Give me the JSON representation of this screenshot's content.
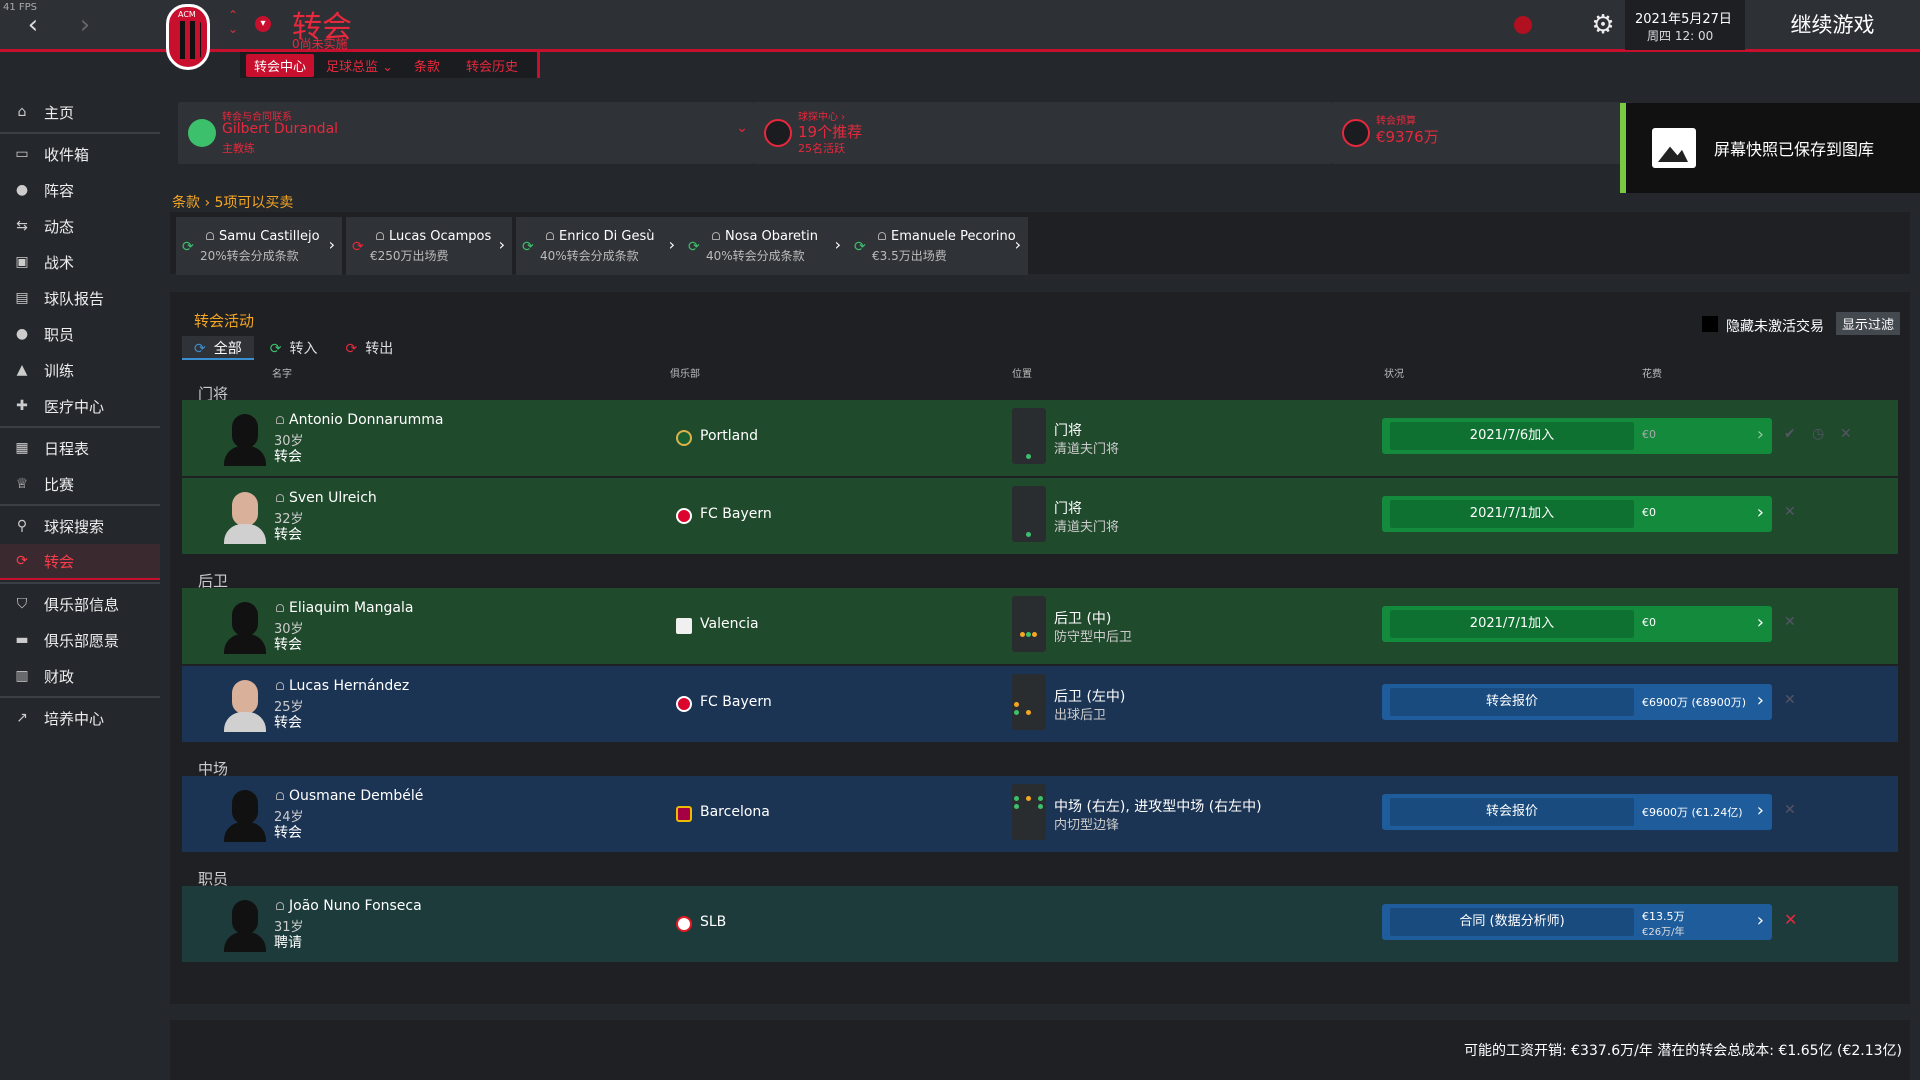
{
  "fps": "41 FPS",
  "header": {
    "title": "转会",
    "subtitle": "0尚未实施",
    "tabs": [
      "转会中心",
      "足球总监",
      "条款",
      "转会历史"
    ],
    "date": "2021年5月27日",
    "day_time": "周四 12: 00",
    "continue_label": "继续游戏",
    "accent_color": "#c8102e"
  },
  "sidebar": {
    "items": [
      {
        "label": "主页",
        "icon": "home-icon"
      },
      {
        "label": "收件箱",
        "icon": "inbox-icon"
      },
      {
        "label": "阵容",
        "icon": "squad-icon"
      },
      {
        "label": "动态",
        "icon": "dynamics-icon"
      },
      {
        "label": "战术",
        "icon": "tactics-icon"
      },
      {
        "label": "球队报告",
        "icon": "report-icon"
      },
      {
        "label": "职员",
        "icon": "staff-icon"
      },
      {
        "label": "训练",
        "icon": "training-icon"
      },
      {
        "label": "医疗中心",
        "icon": "medical-icon"
      },
      {
        "label": "日程表",
        "icon": "calendar-icon"
      },
      {
        "label": "比赛",
        "icon": "trophy-icon"
      },
      {
        "label": "球探搜索",
        "icon": "search-icon"
      },
      {
        "label": "转会",
        "icon": "transfer-icon"
      },
      {
        "label": "俱乐部信息",
        "icon": "shield-icon"
      },
      {
        "label": "俱乐部愿景",
        "icon": "vision-icon"
      },
      {
        "label": "财政",
        "icon": "finance-icon"
      },
      {
        "label": "培养中心",
        "icon": "development-icon"
      }
    ]
  },
  "cards": {
    "contact": {
      "label": "转会与合同联系",
      "name": "Gilbert Durandal",
      "role": "主教练"
    },
    "scouting": {
      "label": "球探中心",
      "value": "19个推荐",
      "sub": "25名活跃"
    },
    "budget": {
      "label": "转会预算",
      "value": "€9376万"
    }
  },
  "toast": {
    "text": "屏幕快照已保存到图库"
  },
  "sell": {
    "link": "条款",
    "title": "5项可以买卖",
    "items": [
      {
        "name": "Samu Castillejo",
        "desc": "20%转会分成条款"
      },
      {
        "name": "Lucas Ocampos",
        "desc": "€250万出场费"
      },
      {
        "name": "Enrico Di Gesù",
        "desc": "40%转会分成条款"
      },
      {
        "name": "Nosa Obaretin",
        "desc": "40%转会分成条款"
      },
      {
        "name": "Emanuele Pecorino",
        "desc": "€3.5万出场费"
      }
    ]
  },
  "activity": {
    "title": "转会活动",
    "filters": [
      "全部",
      "转入",
      "转出"
    ],
    "hide_inactive": "隐藏未激活交易",
    "show_filter": "显示过滤",
    "columns": {
      "name": "名字",
      "club": "俱乐部",
      "position": "位置",
      "status": "状况",
      "fee": "花费"
    },
    "groups": {
      "gk": "门将",
      "def": "后卫",
      "mid": "中场",
      "staff": "职员"
    },
    "rows": [
      {
        "name": "Antonio Donnarumma",
        "age": "30岁",
        "type": "转会",
        "club": "Portland",
        "pos1": "门将",
        "pos2": "清道夫门将",
        "status": "2021/7/6加入",
        "fee": "€0",
        "fee_dim": true
      },
      {
        "name": "Sven Ulreich",
        "age": "32岁",
        "type": "转会",
        "club": "FC Bayern",
        "pos1": "门将",
        "pos2": "清道夫门将",
        "status": "2021/7/1加入",
        "fee": "€0"
      },
      {
        "name": "Eliaquim Mangala",
        "age": "30岁",
        "type": "转会",
        "club": "Valencia",
        "pos1": "后卫 (中)",
        "pos2": "防守型中后卫",
        "status": "2021/7/1加入",
        "fee": "€0"
      },
      {
        "name": "Lucas Hernández",
        "age": "25岁",
        "type": "转会",
        "club": "FC Bayern",
        "pos1": "后卫 (左中)",
        "pos2": "出球后卫",
        "status": "转会报价",
        "fee": "€6900万 (€8900万)"
      },
      {
        "name": "Ousmane Dembélé",
        "age": "24岁",
        "type": "转会",
        "club": "Barcelona",
        "pos1": "中场 (右左), 进攻型中场 (右左中)",
        "pos2": "内切型边锋",
        "status": "转会报价",
        "fee": "€9600万 (€1.24亿)"
      },
      {
        "name": "João Nuno Fonseca",
        "age": "31岁",
        "type": "聘请",
        "club": "SLB",
        "pos1": "",
        "pos2": "",
        "status": "合同 (数据分析师)",
        "fee": "€13.5万",
        "fee_sub": "€26万/年"
      }
    ]
  },
  "footer": {
    "text": "可能的工资开销: €337.6万/年 潜在的转会总成本: €1.65亿 (€2.13亿)"
  }
}
